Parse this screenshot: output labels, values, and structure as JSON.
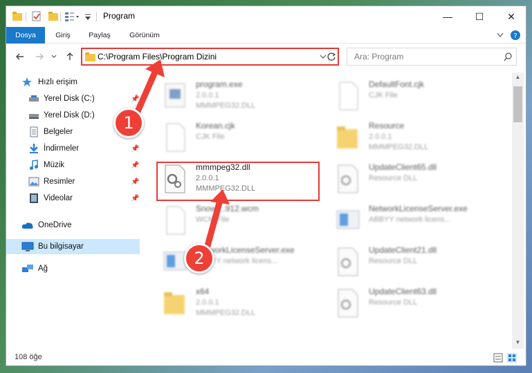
{
  "window": {
    "title": "Program",
    "controls": {
      "minimize": "—",
      "maximize": "☐",
      "close": "✕"
    }
  },
  "ribbon": {
    "tabs": [
      "Dosya",
      "Giriş",
      "Paylaş",
      "Görünüm"
    ]
  },
  "address": {
    "path": "C:\\Program Files\\Program Dizini",
    "search_placeholder": "Ara: Program"
  },
  "sidebar": {
    "quick_access": "Hızlı erişim",
    "items": [
      {
        "label": "Yerel Disk (C:)",
        "icon": "drive-icon",
        "pinned": true
      },
      {
        "label": "Yerel Disk (D:)",
        "icon": "drive-icon",
        "pinned": false
      },
      {
        "label": "Belgeler",
        "icon": "documents-icon",
        "pinned": true
      },
      {
        "label": "İndirmeler",
        "icon": "download-icon",
        "pinned": true
      },
      {
        "label": "Müzik",
        "icon": "music-icon",
        "pinned": true
      },
      {
        "label": "Resimler",
        "icon": "pictures-icon",
        "pinned": true
      },
      {
        "label": "Videolar",
        "icon": "video-icon",
        "pinned": true
      }
    ],
    "onedrive": "OneDrive",
    "this_pc": "Bu bilgisayar",
    "network": "Ağ"
  },
  "files": {
    "left": [
      {
        "name": "program.exe",
        "line1": "2.0.0.1",
        "line2": "MMMPEG32.DLL"
      },
      {
        "name": "Korean.cjk",
        "line1": "CJK File",
        "line2": ""
      },
      {
        "name": "mmmpeg32.dll",
        "line1": "2.0.0.1",
        "line2": "MMMPEG32.DLL"
      },
      {
        "name": "Snowl...912.wcm",
        "line1": "WCM File",
        "line2": ""
      },
      {
        "name": "NetworkLicenseServer.exe",
        "line1": "ABBYY network licens...",
        "line2": ""
      },
      {
        "name": "x64",
        "line1": "2.0.0.1",
        "line2": "MMMPEG32.DLL"
      }
    ],
    "right": [
      {
        "name": "DefaultFont.cjk",
        "line1": "CJK File",
        "line2": ""
      },
      {
        "name": "Resource",
        "line1": "2.0.0.1",
        "line2": "MMMPEG32.DLL"
      },
      {
        "name": "UpdateClient65.dll",
        "line1": "Resource DLL",
        "line2": ""
      },
      {
        "name": "NetworkLicenseServer.exe",
        "line1": "ABBYY network licens...",
        "line2": ""
      },
      {
        "name": "UpdateClient21.dll",
        "line1": "Resource DLL",
        "line2": ""
      },
      {
        "name": "UpdateClient63.dll",
        "line1": "Resource DLL",
        "line2": ""
      }
    ]
  },
  "annotations": {
    "step1": "1",
    "step2": "2"
  },
  "status": {
    "count": "108 öğe"
  },
  "colors": {
    "accent": "#1979ca",
    "highlight": "#e53935",
    "badge": "#ee4036",
    "selected": "#cce8ff"
  }
}
